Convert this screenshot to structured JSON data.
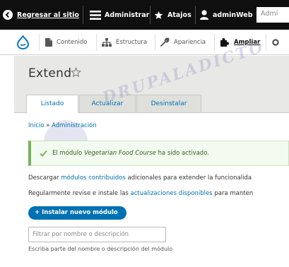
{
  "toolbar": {
    "back_label": "Regresar al sitio",
    "admin_label": "Administrar",
    "shortcuts_label": "Atajos",
    "user_label": "adminWeb",
    "search_partial": "Admi"
  },
  "tray": {
    "items": [
      {
        "label": "Contenido",
        "icon": "file-icon"
      },
      {
        "label": "Estructura",
        "icon": "sitemap-icon"
      },
      {
        "label": "Apariencia",
        "icon": "wrench-icon"
      },
      {
        "label": "Ampliar",
        "icon": "puzzle-icon"
      }
    ]
  },
  "page": {
    "title": "Extend",
    "tabs": [
      {
        "label": "Listado",
        "active": true
      },
      {
        "label": "Actualizar",
        "active": false
      },
      {
        "label": "Desinstalar",
        "active": false
      }
    ],
    "breadcrumb": {
      "home": "Inicio",
      "separator": "»",
      "current": "Administración"
    }
  },
  "message": {
    "prefix": "El módulo ",
    "module_name": "Vegetarian Food Course",
    "suffix": " ha sido activado."
  },
  "info": {
    "line1_before": "Descargar ",
    "line1_link": "módulos contribuidos",
    "line1_after": " adicionales para extender la funcionalida",
    "line2_before": "Regularmente revise e instale las ",
    "line2_link": "actualizaciones disponibles",
    "line2_after": " para manten"
  },
  "actions": {
    "install_label": "+ Instalar nuevo módulo"
  },
  "filter": {
    "placeholder": "Filtrar por nombre o descripción",
    "help": "Escriba parte del nombre o descripción del módulo"
  },
  "watermark": "DRUPALADICTO",
  "colors": {
    "toolbar_bg": "#0f0f0f",
    "link": "#0071b3",
    "drupal_blue": "#0678be",
    "success_border": "#77b259",
    "success_text": "#325e1c"
  }
}
